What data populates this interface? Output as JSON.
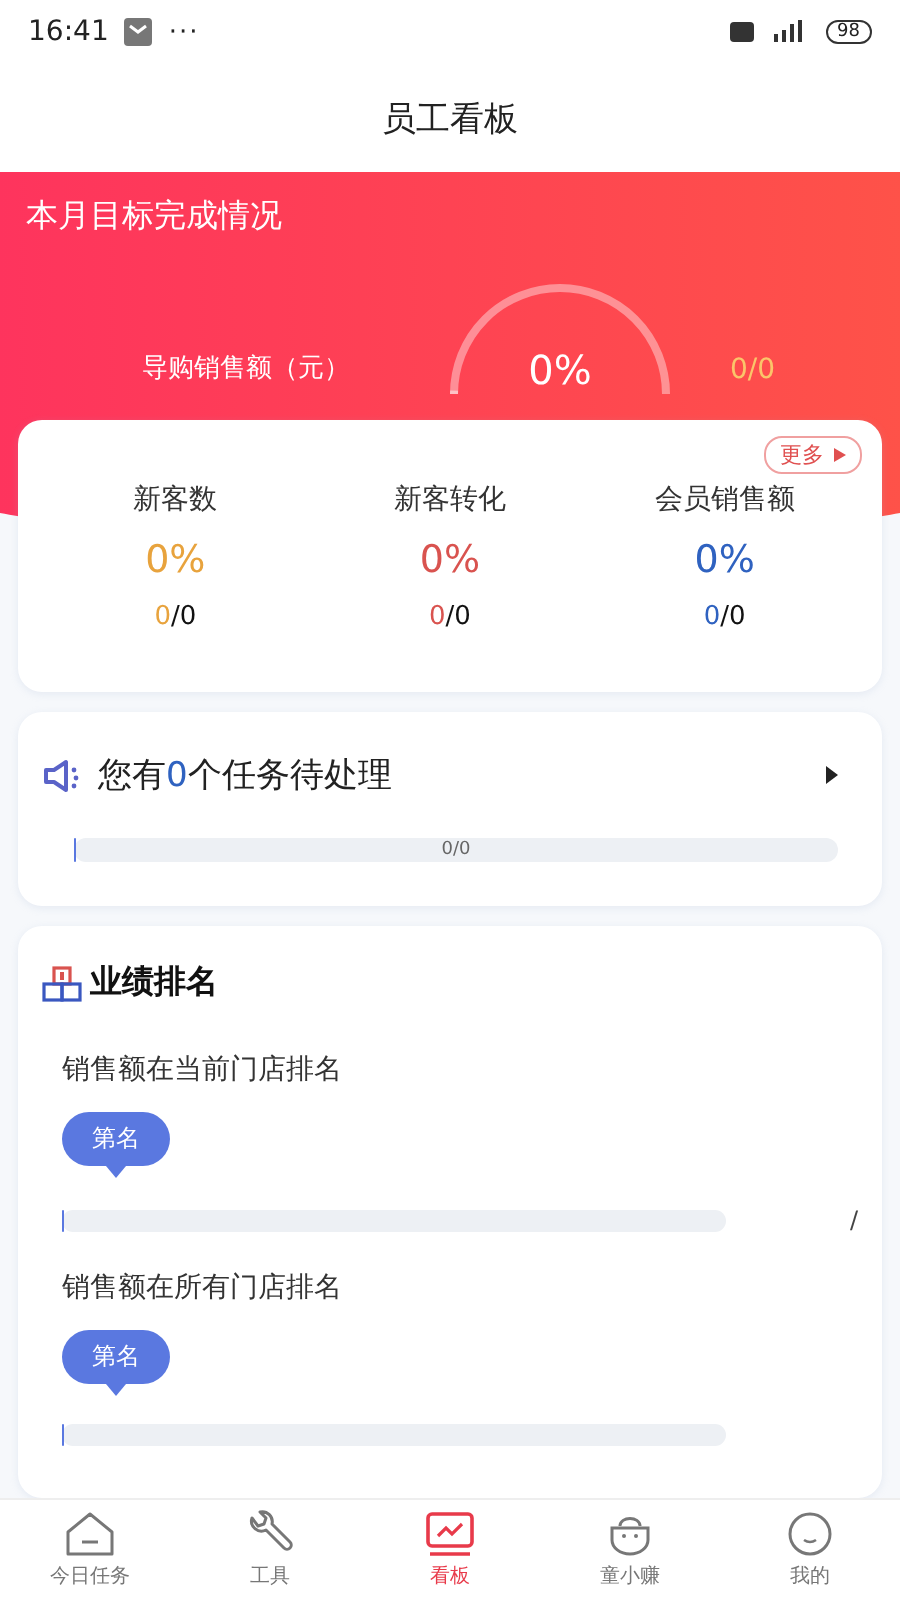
{
  "status_bar": {
    "time": "16:41",
    "dots": "···",
    "battery": "98"
  },
  "header": {
    "title": "员工看板"
  },
  "target": {
    "title": "本月目标完成情况",
    "label": "导购销售额（元）",
    "percent": "0%",
    "level": 0,
    "ratio": "0/0"
  },
  "metrics": {
    "more": "更多",
    "items": [
      {
        "name": "新客数",
        "percent": "0%",
        "done": "0",
        "rest": "/0",
        "color": "#e8a33d"
      },
      {
        "name": "新客转化",
        "percent": "0%",
        "done": "0",
        "rest": "/0",
        "color": "#d9534f"
      },
      {
        "name": "会员销售额",
        "percent": "0%",
        "done": "0",
        "rest": "/0",
        "color": "#2f62c0"
      }
    ]
  },
  "tasks": {
    "before": "您有",
    "count": "0",
    "after": "个任务待处理",
    "progress": "0/0",
    "level": 0
  },
  "ranking": {
    "title": "业绩排名",
    "items": [
      {
        "label": "销售额在当前门店排名",
        "badge": "第名",
        "level": 0,
        "ratio": "/"
      },
      {
        "label": "销售额在所有门店排名",
        "badge": "第名",
        "level": 0
      }
    ]
  },
  "tabbar": [
    {
      "label": "今日任务",
      "kind": "house",
      "selected": false
    },
    {
      "label": "工具",
      "kind": "wrench",
      "selected": false
    },
    {
      "label": "看板",
      "kind": "chart",
      "selected": true
    },
    {
      "label": "童小赚",
      "kind": "pot",
      "selected": false
    },
    {
      "label": "我的",
      "kind": "face",
      "selected": false
    }
  ]
}
